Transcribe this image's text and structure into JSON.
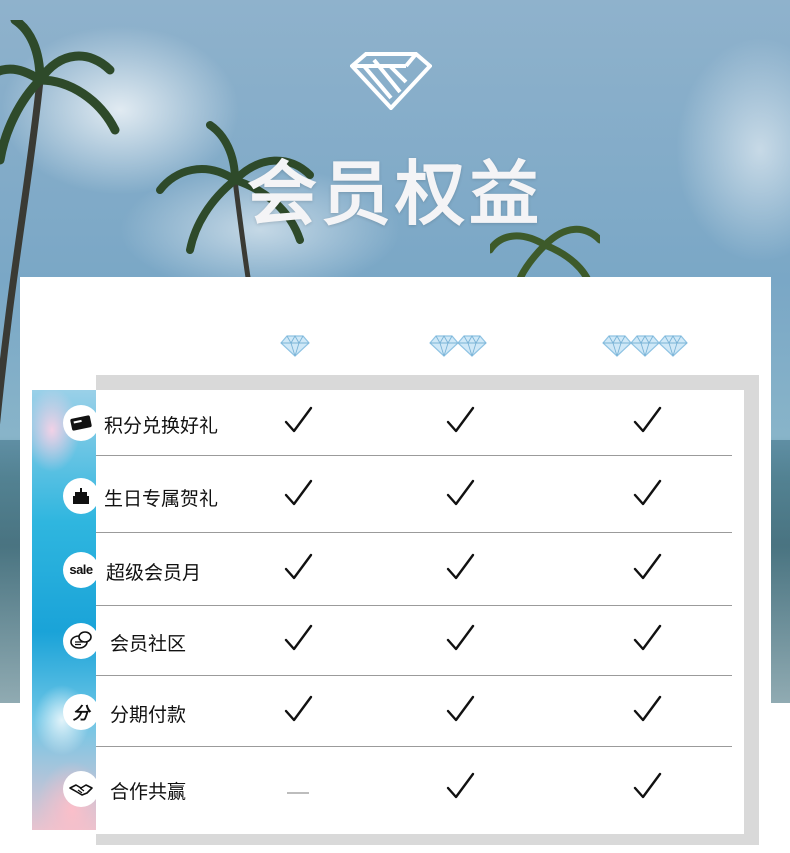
{
  "header": {
    "title": "会员权益"
  },
  "benefits": [
    {
      "label": "积分兑换好礼",
      "icon": "card-icon",
      "tier1": true,
      "tier2": true,
      "tier3": true
    },
    {
      "label": "生日专属贺礼",
      "icon": "cake-icon",
      "tier1": true,
      "tier2": true,
      "tier3": true
    },
    {
      "label": "超级会员月",
      "icon": "sale-icon",
      "icon_text": "sale",
      "tier1": true,
      "tier2": true,
      "tier3": true
    },
    {
      "label": "会员社区",
      "icon": "chat-icon",
      "tier1": true,
      "tier2": true,
      "tier3": true
    },
    {
      "label": "分期付款",
      "icon": "installment-icon",
      "icon_text": "分",
      "tier1": true,
      "tier2": true,
      "tier3": true
    },
    {
      "label": "合作共赢",
      "icon": "handshake-icon",
      "tier1": false,
      "tier2": true,
      "tier3": true
    }
  ],
  "tiers": [
    {
      "diamonds": 1
    },
    {
      "diamonds": 2
    },
    {
      "diamonds": 3
    }
  ],
  "colors": {
    "title": "#f4f4f6",
    "check": "#111111",
    "dash": "#bdbdbd",
    "divider": "#9b9b9b"
  }
}
